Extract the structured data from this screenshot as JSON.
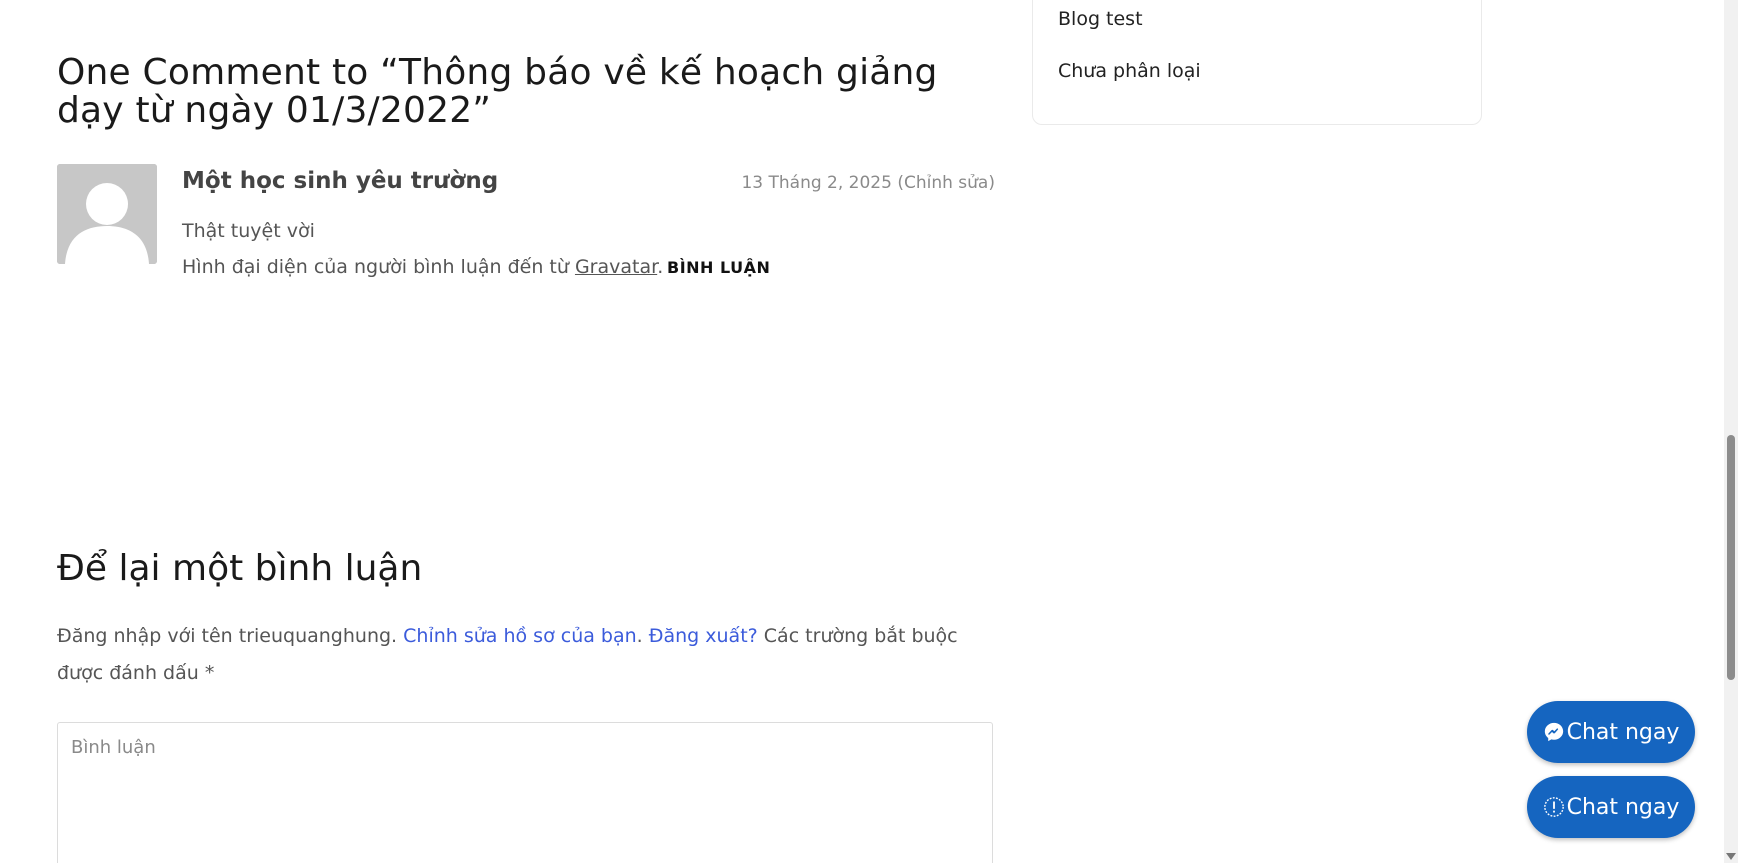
{
  "comments": {
    "title": "One Comment to “Thông báo về kế hoạch giảng dạy từ ngày 01/3/2022”",
    "items": [
      {
        "author": "Một học sinh yêu trường",
        "date": "13 Tháng 2, 2025",
        "edit_open": "(",
        "edit_label": "Chỉnh sửa",
        "edit_close": ")",
        "text": "Thật tuyệt vời",
        "gravatar_prefix": "Hình đại diện của người bình luận đến từ ",
        "gravatar_link": "Gravatar",
        "gravatar_suffix": ".",
        "reply_label": "BÌNH LUẬN"
      }
    ]
  },
  "reply_form": {
    "title": "Để lại một bình luận",
    "logged_in_prefix": "Đăng nhập với tên trieuquanghung. ",
    "edit_profile_link": "Chỉnh sửa hồ sơ của bạn",
    "sep": ". ",
    "logout_link": "Đăng xuất?",
    "required_note": " Các trường bắt buộc được đánh dấu ",
    "required_mark": "*",
    "comment_placeholder": "Bình luận"
  },
  "sidebar": {
    "categories": [
      {
        "label": "Blog test"
      },
      {
        "label": "Chưa phân loại"
      }
    ]
  },
  "chat_buttons": [
    {
      "label": "Chat ngay",
      "icon": "messenger-icon"
    },
    {
      "label": "Chat ngay",
      "icon": "zalo-icon"
    }
  ],
  "colors": {
    "link": "#3b5bdb",
    "chat_button": "#1565c0"
  }
}
